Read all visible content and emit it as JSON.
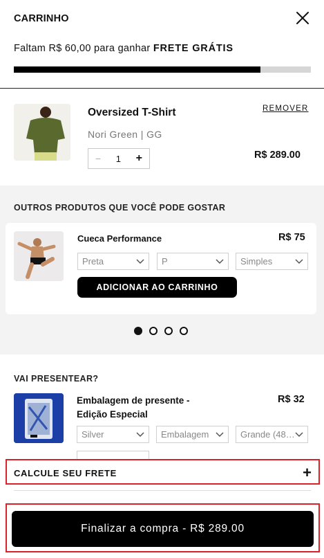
{
  "header": {
    "title": "CARRINHO",
    "free_shipping_prefix": "Faltam R$ 60,00 para ganhar",
    "free_shipping_bold": "FRETE GRÁTIS",
    "progress_fraction": 0.83
  },
  "cart": {
    "items": [
      {
        "name": "Oversized T-Shirt",
        "variant": "Nori Green | GG",
        "quantity": "1",
        "price": "R$ 289.00",
        "remove_label": "REMOVER"
      }
    ]
  },
  "recommendations": {
    "title": "OUTROS PRODUTOS QUE VOCÊ PODE GOSTAR",
    "product": {
      "name": "Cueca Performance",
      "price": "R$ 75",
      "color_select": "Preta",
      "size_select": "P",
      "pack_select": "Simples",
      "add_button": "ADICIONAR AO CARRINHO"
    },
    "carousel": {
      "pages": 4,
      "active": 0
    }
  },
  "gift": {
    "title": "VAI PRESENTEAR?",
    "name_line1": "Embalagem de presente -",
    "name_line2": "Edição Especial",
    "price": "R$ 32",
    "color_select": "Silver",
    "type_select": "Embalagem",
    "size_select": "Grande (48…"
  },
  "shipping": {
    "label": "CALCULE SEU FRETE",
    "icon": "plus-icon"
  },
  "checkout": {
    "label": "Finalizar a compra - R$ 289.00"
  },
  "colors": {
    "accent": "#000000",
    "highlight_border": "#d9222a",
    "progress_track": "#d6d6d6"
  }
}
